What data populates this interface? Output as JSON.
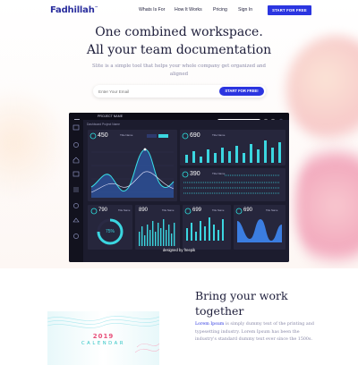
{
  "brand": {
    "logo_text": "Fadhillah",
    "logo_mark": "™",
    "accent": "#2b35e0"
  },
  "nav": {
    "links": [
      "Whats Is For",
      "How It Works",
      "Pricing",
      "Sign In"
    ],
    "cta_label": "START FOR FREE"
  },
  "hero": {
    "headline_line1": "One combined workspace.",
    "headline_line2": "All your team documentation",
    "subtext": "Slite is a simple tool that helps your whole company get organized and aligned",
    "email_placeholder": "Enter Your Email",
    "email_button_label": "START FOR FREE!"
  },
  "dashboard": {
    "project_name": "PROJECT NAME",
    "breadcrumb": "Dashboard  Project Name",
    "credit": "designed by freepik",
    "cards": [
      {
        "value": "450",
        "label": "Title Name"
      },
      {
        "value": "690",
        "label": "Title Name"
      },
      {
        "value": "390",
        "label": "Title Name"
      },
      {
        "value": "790",
        "label": "Title Name"
      },
      {
        "value": "890",
        "label": "Title Name"
      },
      {
        "value": "699",
        "label": "Title Name"
      },
      {
        "value": "690",
        "label": "Title Name"
      }
    ],
    "gauge_value": "75%"
  },
  "feature": {
    "title_line1": "Bring your work",
    "title_line2": "together",
    "body_lead": "Lorem Ipsum",
    "body_rest": " is simply dummy text of the printing and typesetting industry. Lorem Ipsum has been the industry's standard dummy text ever since the 1500s."
  },
  "calendar": {
    "year": "2019",
    "word": "CALENDAR"
  }
}
